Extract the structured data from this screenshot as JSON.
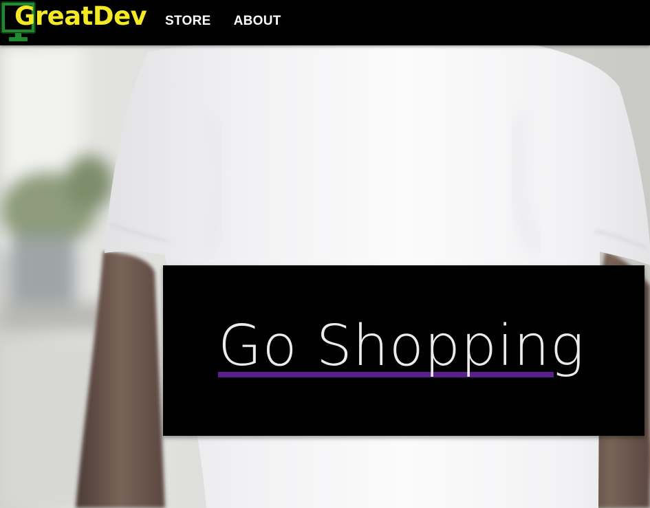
{
  "navbar": {
    "brand": "GreatDev",
    "links": [
      {
        "label": "STORE"
      },
      {
        "label": "ABOUT"
      }
    ]
  },
  "hero": {
    "cta_label": "Go Shopping"
  },
  "colors": {
    "navbar_bg": "#000000",
    "brand_text": "#f4e925",
    "brand_icon": "#1f8a2e",
    "cta_bg": "#000000",
    "cta_text": "#ebebeb",
    "cta_underline": "#5a1f8c"
  },
  "icons": {
    "brand_icon": "monitor-icon"
  }
}
